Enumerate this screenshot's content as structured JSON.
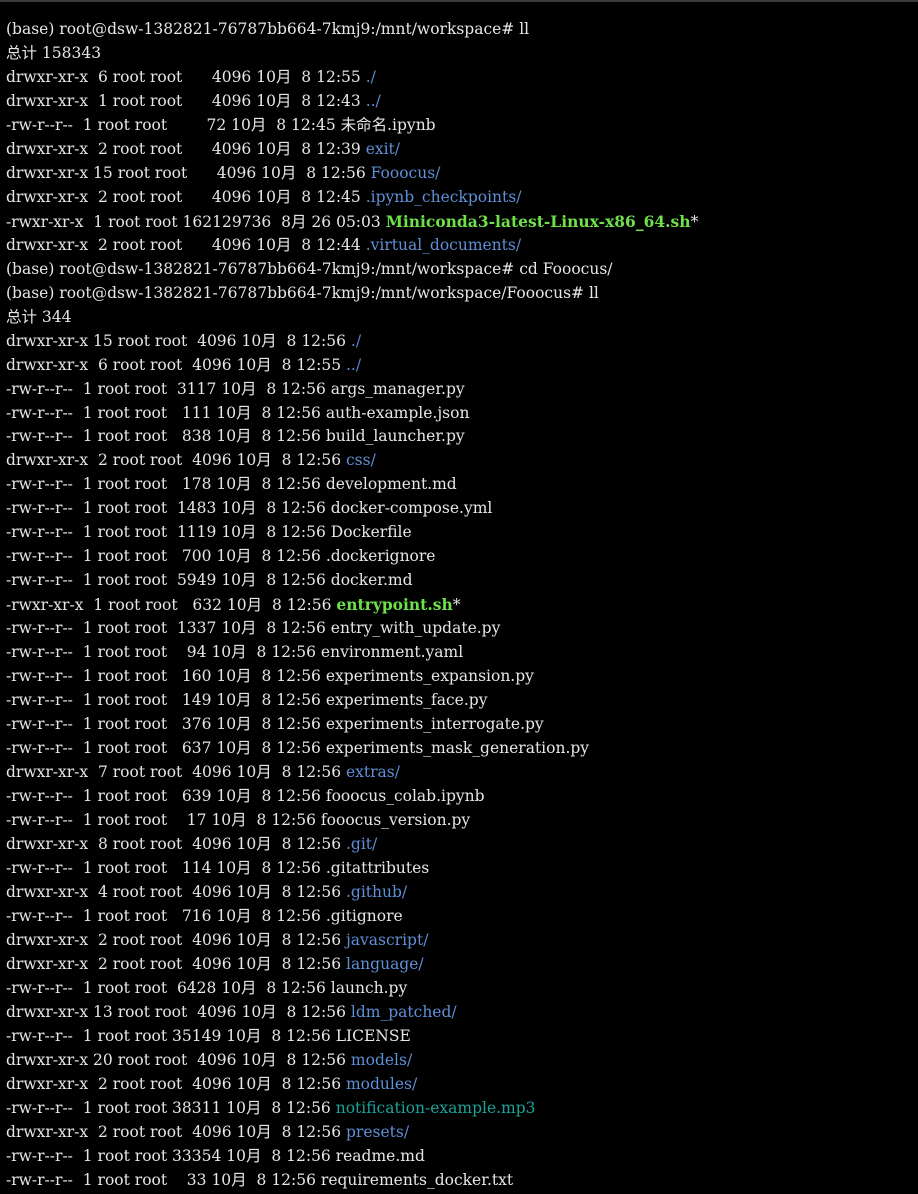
{
  "terminal": {
    "lines": [
      {
        "kind": "prompt",
        "segments": [
          {
            "t": "(base) root@dsw-1382821-76787bb664-7kmj9:/mnt/workspace# ll",
            "c": "plain"
          }
        ]
      },
      {
        "kind": "total",
        "segments": [
          {
            "t": "总计 158343",
            "c": "plain"
          }
        ]
      },
      {
        "kind": "entry",
        "segments": [
          {
            "t": "drwxr-xr-x  6 root root      4096 10月  8 12:55 ",
            "c": "plain"
          },
          {
            "t": "./",
            "c": "dir"
          }
        ]
      },
      {
        "kind": "entry",
        "segments": [
          {
            "t": "drwxr-xr-x  1 root root      4096 10月  8 12:43 ",
            "c": "plain"
          },
          {
            "t": "../",
            "c": "dir"
          }
        ]
      },
      {
        "kind": "entry",
        "segments": [
          {
            "t": "-rw-r--r--  1 root root        72 10月  8 12:45 ",
            "c": "plain"
          },
          {
            "t": "未命名.ipynb",
            "c": "plain"
          }
        ]
      },
      {
        "kind": "entry",
        "segments": [
          {
            "t": "drwxr-xr-x  2 root root      4096 10月  8 12:39 ",
            "c": "plain"
          },
          {
            "t": "exit",
            "c": "dir"
          },
          {
            "t": "/",
            "c": "dir"
          }
        ]
      },
      {
        "kind": "entry",
        "segments": [
          {
            "t": "drwxr-xr-x 15 root root      4096 10月  8 12:56 ",
            "c": "plain"
          },
          {
            "t": "Fooocus",
            "c": "dir"
          },
          {
            "t": "/",
            "c": "dir"
          }
        ]
      },
      {
        "kind": "entry",
        "segments": [
          {
            "t": "drwxr-xr-x  2 root root      4096 10月  8 12:45 ",
            "c": "plain"
          },
          {
            "t": ".ipynb_checkpoints",
            "c": "dir"
          },
          {
            "t": "/",
            "c": "dir"
          }
        ]
      },
      {
        "kind": "entry",
        "segments": [
          {
            "t": "-rwxr-xr-x  1 root root 162129736  8月 26 05:03 ",
            "c": "plain"
          },
          {
            "t": "Miniconda3-latest-Linux-x86_64.sh",
            "c": "exec"
          },
          {
            "t": "*",
            "c": "star"
          }
        ]
      },
      {
        "kind": "entry",
        "segments": [
          {
            "t": "drwxr-xr-x  2 root root      4096 10月  8 12:44 ",
            "c": "plain"
          },
          {
            "t": ".virtual_documents",
            "c": "dir"
          },
          {
            "t": "/",
            "c": "dir"
          }
        ]
      },
      {
        "kind": "prompt",
        "segments": [
          {
            "t": "(base) root@dsw-1382821-76787bb664-7kmj9:/mnt/workspace# cd Fooocus/",
            "c": "plain"
          }
        ]
      },
      {
        "kind": "prompt",
        "segments": [
          {
            "t": "(base) root@dsw-1382821-76787bb664-7kmj9:/mnt/workspace/Fooocus# ll",
            "c": "plain"
          }
        ]
      },
      {
        "kind": "total",
        "segments": [
          {
            "t": "总计 344",
            "c": "plain"
          }
        ]
      },
      {
        "kind": "entry",
        "segments": [
          {
            "t": "drwxr-xr-x 15 root root  4096 10月  8 12:56 ",
            "c": "plain"
          },
          {
            "t": "./",
            "c": "dir"
          }
        ]
      },
      {
        "kind": "entry",
        "segments": [
          {
            "t": "drwxr-xr-x  6 root root  4096 10月  8 12:55 ",
            "c": "plain"
          },
          {
            "t": "../",
            "c": "dir"
          }
        ]
      },
      {
        "kind": "entry",
        "segments": [
          {
            "t": "-rw-r--r--  1 root root  3117 10月  8 12:56 ",
            "c": "plain"
          },
          {
            "t": "args_manager.py",
            "c": "plain"
          }
        ]
      },
      {
        "kind": "entry",
        "segments": [
          {
            "t": "-rw-r--r--  1 root root   111 10月  8 12:56 ",
            "c": "plain"
          },
          {
            "t": "auth-example.json",
            "c": "plain"
          }
        ]
      },
      {
        "kind": "entry",
        "segments": [
          {
            "t": "-rw-r--r--  1 root root   838 10月  8 12:56 ",
            "c": "plain"
          },
          {
            "t": "build_launcher.py",
            "c": "plain"
          }
        ]
      },
      {
        "kind": "entry",
        "segments": [
          {
            "t": "drwxr-xr-x  2 root root  4096 10月  8 12:56 ",
            "c": "plain"
          },
          {
            "t": "css",
            "c": "dir"
          },
          {
            "t": "/",
            "c": "dir"
          }
        ]
      },
      {
        "kind": "entry",
        "segments": [
          {
            "t": "-rw-r--r--  1 root root   178 10月  8 12:56 ",
            "c": "plain"
          },
          {
            "t": "development.md",
            "c": "plain"
          }
        ]
      },
      {
        "kind": "entry",
        "segments": [
          {
            "t": "-rw-r--r--  1 root root  1483 10月  8 12:56 ",
            "c": "plain"
          },
          {
            "t": "docker-compose.yml",
            "c": "plain"
          }
        ]
      },
      {
        "kind": "entry",
        "segments": [
          {
            "t": "-rw-r--r--  1 root root  1119 10月  8 12:56 ",
            "c": "plain"
          },
          {
            "t": "Dockerfile",
            "c": "plain"
          }
        ]
      },
      {
        "kind": "entry",
        "segments": [
          {
            "t": "-rw-r--r--  1 root root   700 10月  8 12:56 ",
            "c": "plain"
          },
          {
            "t": ".dockerignore",
            "c": "plain"
          }
        ]
      },
      {
        "kind": "entry",
        "segments": [
          {
            "t": "-rw-r--r--  1 root root  5949 10月  8 12:56 ",
            "c": "plain"
          },
          {
            "t": "docker.md",
            "c": "plain"
          }
        ]
      },
      {
        "kind": "entry",
        "segments": [
          {
            "t": "-rwxr-xr-x  1 root root   632 10月  8 12:56 ",
            "c": "plain"
          },
          {
            "t": "entrypoint.sh",
            "c": "exec"
          },
          {
            "t": "*",
            "c": "star"
          }
        ]
      },
      {
        "kind": "entry",
        "segments": [
          {
            "t": "-rw-r--r--  1 root root  1337 10月  8 12:56 ",
            "c": "plain"
          },
          {
            "t": "entry_with_update.py",
            "c": "plain"
          }
        ]
      },
      {
        "kind": "entry",
        "segments": [
          {
            "t": "-rw-r--r--  1 root root    94 10月  8 12:56 ",
            "c": "plain"
          },
          {
            "t": "environment.yaml",
            "c": "plain"
          }
        ]
      },
      {
        "kind": "entry",
        "segments": [
          {
            "t": "-rw-r--r--  1 root root   160 10月  8 12:56 ",
            "c": "plain"
          },
          {
            "t": "experiments_expansion.py",
            "c": "plain"
          }
        ]
      },
      {
        "kind": "entry",
        "segments": [
          {
            "t": "-rw-r--r--  1 root root   149 10月  8 12:56 ",
            "c": "plain"
          },
          {
            "t": "experiments_face.py",
            "c": "plain"
          }
        ]
      },
      {
        "kind": "entry",
        "segments": [
          {
            "t": "-rw-r--r--  1 root root   376 10月  8 12:56 ",
            "c": "plain"
          },
          {
            "t": "experiments_interrogate.py",
            "c": "plain"
          }
        ]
      },
      {
        "kind": "entry",
        "segments": [
          {
            "t": "-rw-r--r--  1 root root   637 10月  8 12:56 ",
            "c": "plain"
          },
          {
            "t": "experiments_mask_generation.py",
            "c": "plain"
          }
        ]
      },
      {
        "kind": "entry",
        "segments": [
          {
            "t": "drwxr-xr-x  7 root root  4096 10月  8 12:56 ",
            "c": "plain"
          },
          {
            "t": "extras",
            "c": "dir"
          },
          {
            "t": "/",
            "c": "dir"
          }
        ]
      },
      {
        "kind": "entry",
        "segments": [
          {
            "t": "-rw-r--r--  1 root root   639 10月  8 12:56 ",
            "c": "plain"
          },
          {
            "t": "fooocus_colab.ipynb",
            "c": "plain"
          }
        ]
      },
      {
        "kind": "entry",
        "segments": [
          {
            "t": "-rw-r--r--  1 root root    17 10月  8 12:56 ",
            "c": "plain"
          },
          {
            "t": "fooocus_version.py",
            "c": "plain"
          }
        ]
      },
      {
        "kind": "entry",
        "segments": [
          {
            "t": "drwxr-xr-x  8 root root  4096 10月  8 12:56 ",
            "c": "plain"
          },
          {
            "t": ".git",
            "c": "dir"
          },
          {
            "t": "/",
            "c": "dir"
          }
        ]
      },
      {
        "kind": "entry",
        "segments": [
          {
            "t": "-rw-r--r--  1 root root   114 10月  8 12:56 ",
            "c": "plain"
          },
          {
            "t": ".gitattributes",
            "c": "plain"
          }
        ]
      },
      {
        "kind": "entry",
        "segments": [
          {
            "t": "drwxr-xr-x  4 root root  4096 10月  8 12:56 ",
            "c": "plain"
          },
          {
            "t": ".github",
            "c": "dir"
          },
          {
            "t": "/",
            "c": "dir"
          }
        ]
      },
      {
        "kind": "entry",
        "segments": [
          {
            "t": "-rw-r--r--  1 root root   716 10月  8 12:56 ",
            "c": "plain"
          },
          {
            "t": ".gitignore",
            "c": "plain"
          }
        ]
      },
      {
        "kind": "entry",
        "segments": [
          {
            "t": "drwxr-xr-x  2 root root  4096 10月  8 12:56 ",
            "c": "plain"
          },
          {
            "t": "javascript",
            "c": "dir"
          },
          {
            "t": "/",
            "c": "dir"
          }
        ]
      },
      {
        "kind": "entry",
        "segments": [
          {
            "t": "drwxr-xr-x  2 root root  4096 10月  8 12:56 ",
            "c": "plain"
          },
          {
            "t": "language",
            "c": "dir"
          },
          {
            "t": "/",
            "c": "dir"
          }
        ]
      },
      {
        "kind": "entry",
        "segments": [
          {
            "t": "-rw-r--r--  1 root root  6428 10月  8 12:56 ",
            "c": "plain"
          },
          {
            "t": "launch.py",
            "c": "plain"
          }
        ]
      },
      {
        "kind": "entry",
        "segments": [
          {
            "t": "drwxr-xr-x 13 root root  4096 10月  8 12:56 ",
            "c": "plain"
          },
          {
            "t": "ldm_patched",
            "c": "dir"
          },
          {
            "t": "/",
            "c": "dir"
          }
        ]
      },
      {
        "kind": "entry",
        "segments": [
          {
            "t": "-rw-r--r--  1 root root 35149 10月  8 12:56 ",
            "c": "plain"
          },
          {
            "t": "LICENSE",
            "c": "plain"
          }
        ]
      },
      {
        "kind": "entry",
        "segments": [
          {
            "t": "drwxr-xr-x 20 root root  4096 10月  8 12:56 ",
            "c": "plain"
          },
          {
            "t": "models",
            "c": "dir"
          },
          {
            "t": "/",
            "c": "dir"
          }
        ]
      },
      {
        "kind": "entry",
        "segments": [
          {
            "t": "drwxr-xr-x  2 root root  4096 10月  8 12:56 ",
            "c": "plain"
          },
          {
            "t": "modules",
            "c": "dir"
          },
          {
            "t": "/",
            "c": "dir"
          }
        ]
      },
      {
        "kind": "entry",
        "segments": [
          {
            "t": "-rw-r--r--  1 root root 38311 10月  8 12:56 ",
            "c": "plain"
          },
          {
            "t": "notification-example.mp3",
            "c": "media"
          }
        ]
      },
      {
        "kind": "entry",
        "segments": [
          {
            "t": "drwxr-xr-x  2 root root  4096 10月  8 12:56 ",
            "c": "plain"
          },
          {
            "t": "presets",
            "c": "dir"
          },
          {
            "t": "/",
            "c": "dir"
          }
        ]
      },
      {
        "kind": "entry",
        "segments": [
          {
            "t": "-rw-r--r--  1 root root 33354 10月  8 12:56 ",
            "c": "plain"
          },
          {
            "t": "readme.md",
            "c": "plain"
          }
        ]
      },
      {
        "kind": "entry",
        "segments": [
          {
            "t": "-rw-r--r--  1 root root    33 10月  8 12:56 ",
            "c": "plain"
          },
          {
            "t": "requirements_docker.txt",
            "c": "plain"
          }
        ]
      }
    ]
  },
  "colors": {
    "background": "#000000",
    "text": "#e6e6e6",
    "directory": "#5f8fd6",
    "executable": "#6ee04a",
    "media": "#1aa39a"
  }
}
